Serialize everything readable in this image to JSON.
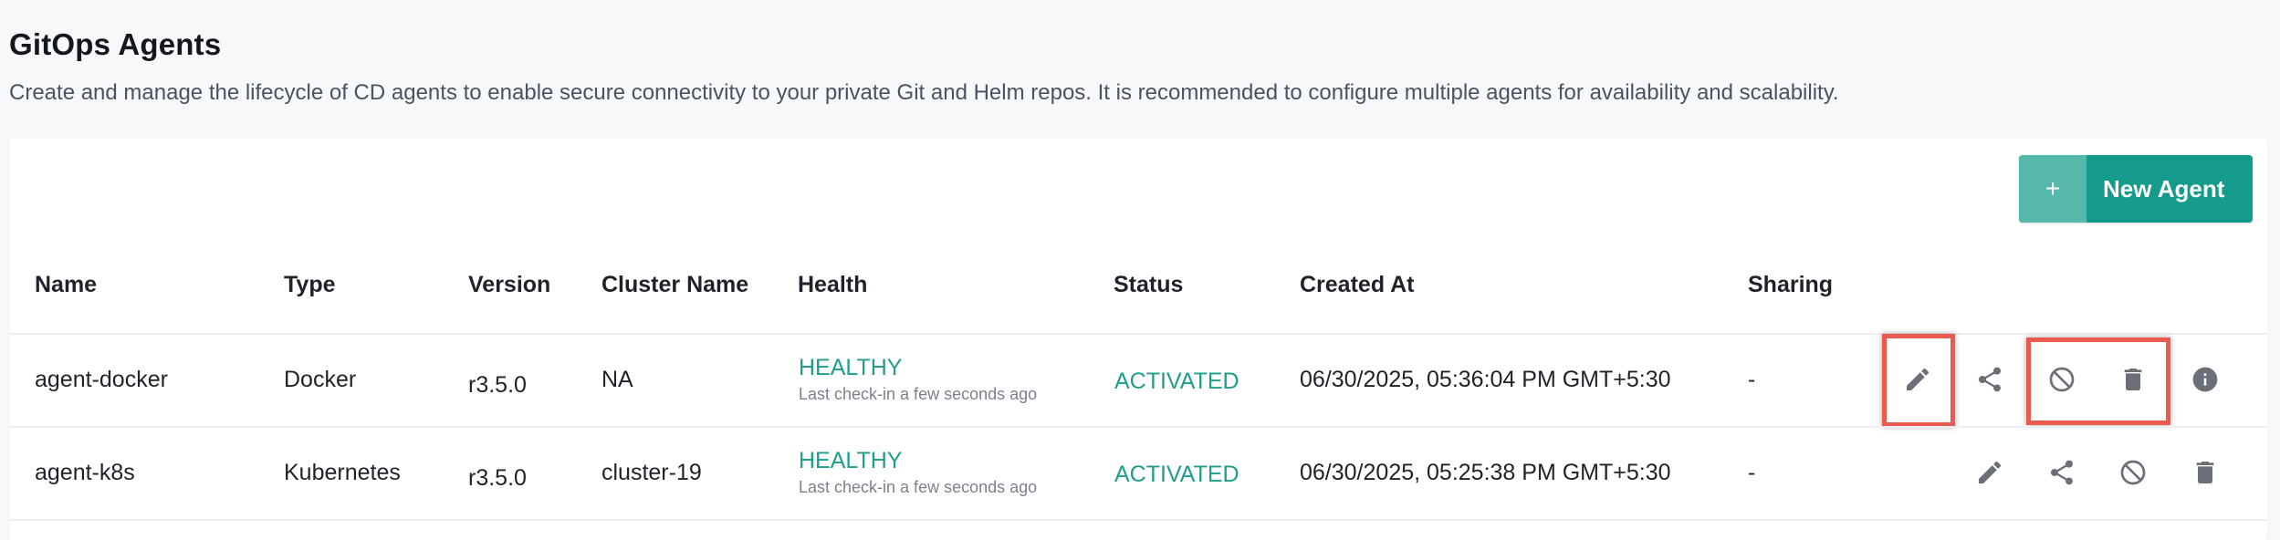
{
  "page": {
    "title": "GitOps Agents",
    "subtitle": "Create and manage the lifecycle of CD agents to enable secure connectivity to your private Git and Helm repos. It is recommended to configure multiple agents for availability and scalability."
  },
  "toolbar": {
    "new_agent_label": "New Agent",
    "new_agent_icon": "+"
  },
  "table": {
    "columns": [
      "Name",
      "Type",
      "Version",
      "Cluster Name",
      "Health",
      "Status",
      "Created At",
      "Sharing"
    ],
    "rows": [
      {
        "name": "agent-docker",
        "type": "Docker",
        "version": "r3.5.0",
        "cluster": "NA",
        "health": "HEALTHY",
        "health_sub": "Last check-in  a few seconds ago",
        "status": "ACTIVATED",
        "created": "06/30/2025, 05:36:04 PM GMT+5:30",
        "sharing": "-",
        "actions": [
          "edit-icon",
          "share-icon",
          "disable-icon",
          "delete-icon",
          "info-icon"
        ]
      },
      {
        "name": "agent-k8s",
        "type": "Kubernetes",
        "version": "r3.5.0",
        "cluster": "cluster-19",
        "health": "HEALTHY",
        "health_sub": "Last check-in  a few seconds ago",
        "status": "ACTIVATED",
        "created": "06/30/2025, 05:25:38 PM GMT+5:30",
        "sharing": "-",
        "actions": [
          "edit-icon",
          "share-icon",
          "disable-icon",
          "delete-icon"
        ]
      }
    ]
  },
  "colors": {
    "accent": "#149b8b",
    "healthy": "#1f9e8c",
    "highlight": "#ea5a4f"
  }
}
